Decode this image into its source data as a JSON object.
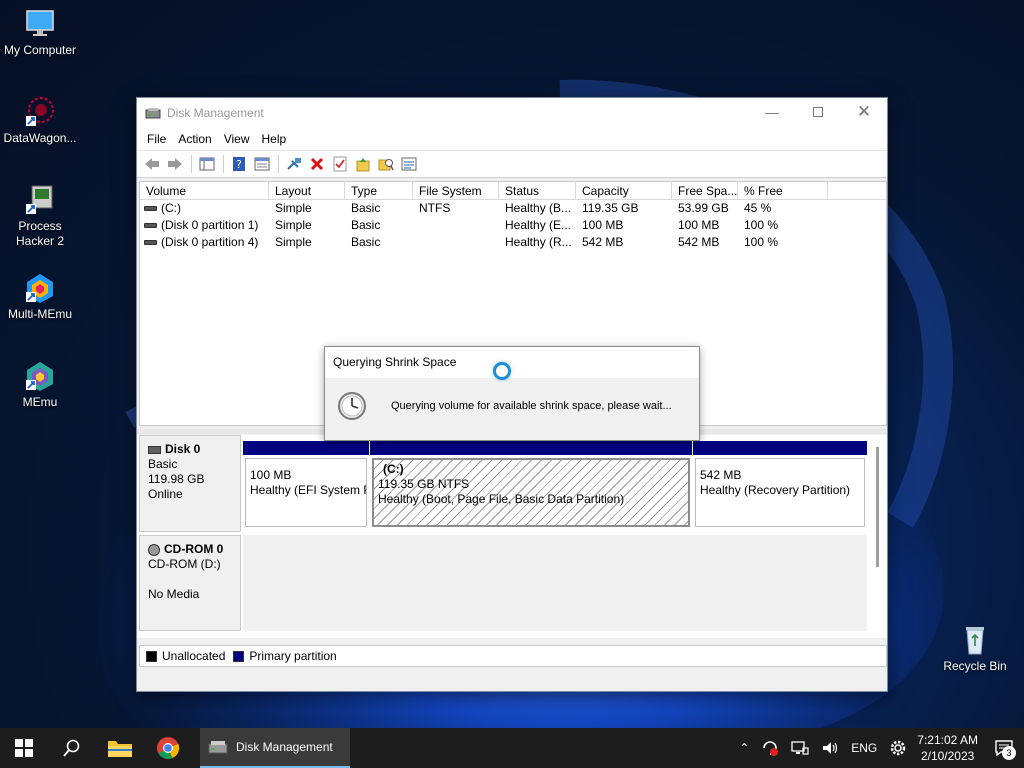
{
  "desktop": {
    "icons": [
      {
        "label": "My Computer"
      },
      {
        "label": "DataWagon..."
      },
      {
        "label": "Process Hacker 2"
      },
      {
        "label": "Multi-MEmu"
      },
      {
        "label": "MEmu"
      },
      {
        "label": "Recycle Bin"
      }
    ]
  },
  "window": {
    "title": "Disk Management",
    "menu": [
      "File",
      "Action",
      "View",
      "Help"
    ]
  },
  "volume_table": {
    "columns": [
      "Volume",
      "Layout",
      "Type",
      "File System",
      "Status",
      "Capacity",
      "Free Spa...",
      "% Free"
    ],
    "rows": [
      {
        "volume": "(C:)",
        "layout": "Simple",
        "type": "Basic",
        "fs": "NTFS",
        "status": "Healthy (B...",
        "capacity": "119.35 GB",
        "free": "53.99 GB",
        "pct": "45 %"
      },
      {
        "volume": "(Disk 0 partition 1)",
        "layout": "Simple",
        "type": "Basic",
        "fs": "",
        "status": "Healthy (E...",
        "capacity": "100 MB",
        "free": "100 MB",
        "pct": "100 %"
      },
      {
        "volume": "(Disk 0 partition 4)",
        "layout": "Simple",
        "type": "Basic",
        "fs": "",
        "status": "Healthy (R...",
        "capacity": "542 MB",
        "free": "542 MB",
        "pct": "100 %"
      }
    ]
  },
  "disks": {
    "disk0": {
      "name": "Disk 0",
      "type": "Basic",
      "size": "119.98 GB",
      "state": "Online"
    },
    "partitions": [
      {
        "title": "",
        "size": "100 MB",
        "status": "Healthy (EFI System P"
      },
      {
        "title": "(C:)",
        "size": "119.35 GB NTFS",
        "status": "Healthy (Boot, Page File, Basic Data Partition)"
      },
      {
        "title": "",
        "size": "542 MB",
        "status": "Healthy (Recovery Partition)"
      }
    ],
    "cdrom": {
      "name": "CD-ROM 0",
      "drive": "CD-ROM (D:)",
      "media": "No Media"
    }
  },
  "legend": {
    "unallocated": "Unallocated",
    "primary": "Primary partition",
    "unallocated_color": "#000000",
    "primary_color": "#000080"
  },
  "dialog": {
    "title": "Querying Shrink Space",
    "message": "Querying volume for available shrink space, please wait..."
  },
  "taskbar": {
    "active_app": "Disk Management",
    "language": "ENG",
    "time": "7:21:02 AM",
    "date": "2/10/2023",
    "notification_count": "3"
  }
}
